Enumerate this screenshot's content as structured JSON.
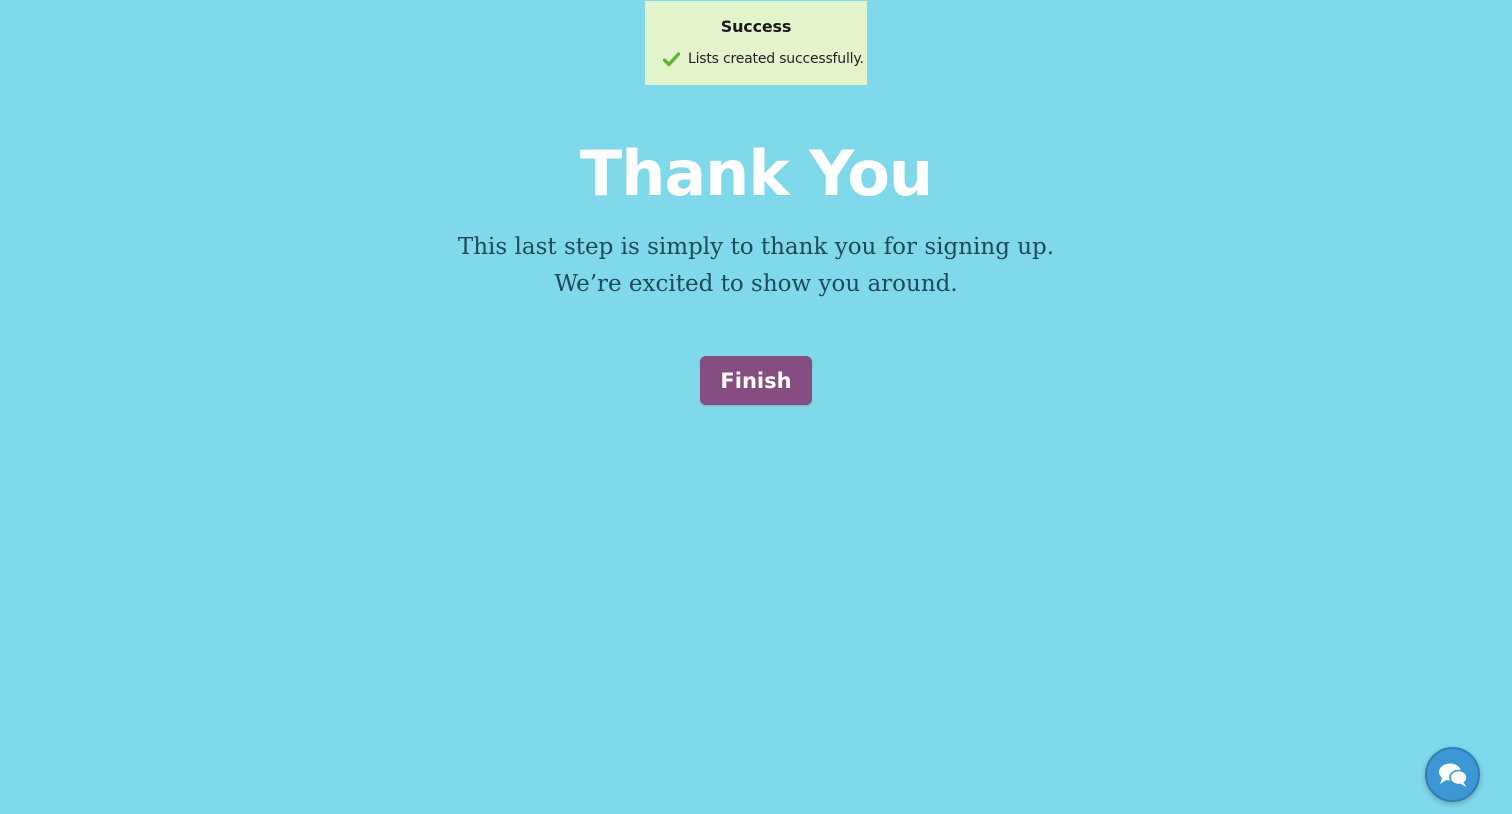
{
  "colors": {
    "background": "#80d9eb",
    "toast_background": "#e3f4cc",
    "success_check": "#5cb531",
    "heading_text": "#ffffff",
    "body_text": "#1e4a5a",
    "finish_button": "#864d81",
    "chat_button": "#3d97d4"
  },
  "toast": {
    "title": "Success",
    "message": "Lists created successfully.",
    "icon": "check-icon"
  },
  "page": {
    "heading": "Thank You",
    "line1": "This last step is simply to thank you for signing up.",
    "line2": "We’re excited to show you around."
  },
  "actions": {
    "finish_label": "Finish"
  },
  "chat_widget": {
    "icon": "chat-bubbles-icon"
  }
}
